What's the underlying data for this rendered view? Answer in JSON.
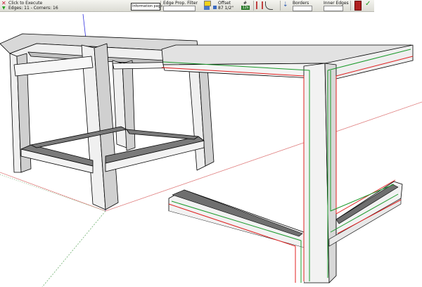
{
  "toolbar": {
    "status_line1": "Click to Execute",
    "status_line2": "Edges: 11 - Corners: 16",
    "info_button": "Information page",
    "edge_prop_filter": "Edge Prop. Filter",
    "offset_label": "Offset",
    "offset_value": "87 1/2\"",
    "count_label": "#",
    "count_value": "12s",
    "borders_label": "Borders",
    "inner_edges_label": "Inner Edges",
    "colors": {
      "close": "#c8102e",
      "execute": "#1a9e1a",
      "swatch": "#f2d21b",
      "badge": "#2b7a2b"
    }
  },
  "scene": {
    "description_icons": [
      "close-icon",
      "play-icon",
      "validate-icon",
      "exit-icon"
    ],
    "colors": {
      "frame_face": "#e6e6e6",
      "frame_shadow": "#7f7f7f",
      "edge_red": "#e02020",
      "edge_green": "#1a9a2a",
      "axis_blue": "#2a2ae0"
    }
  }
}
